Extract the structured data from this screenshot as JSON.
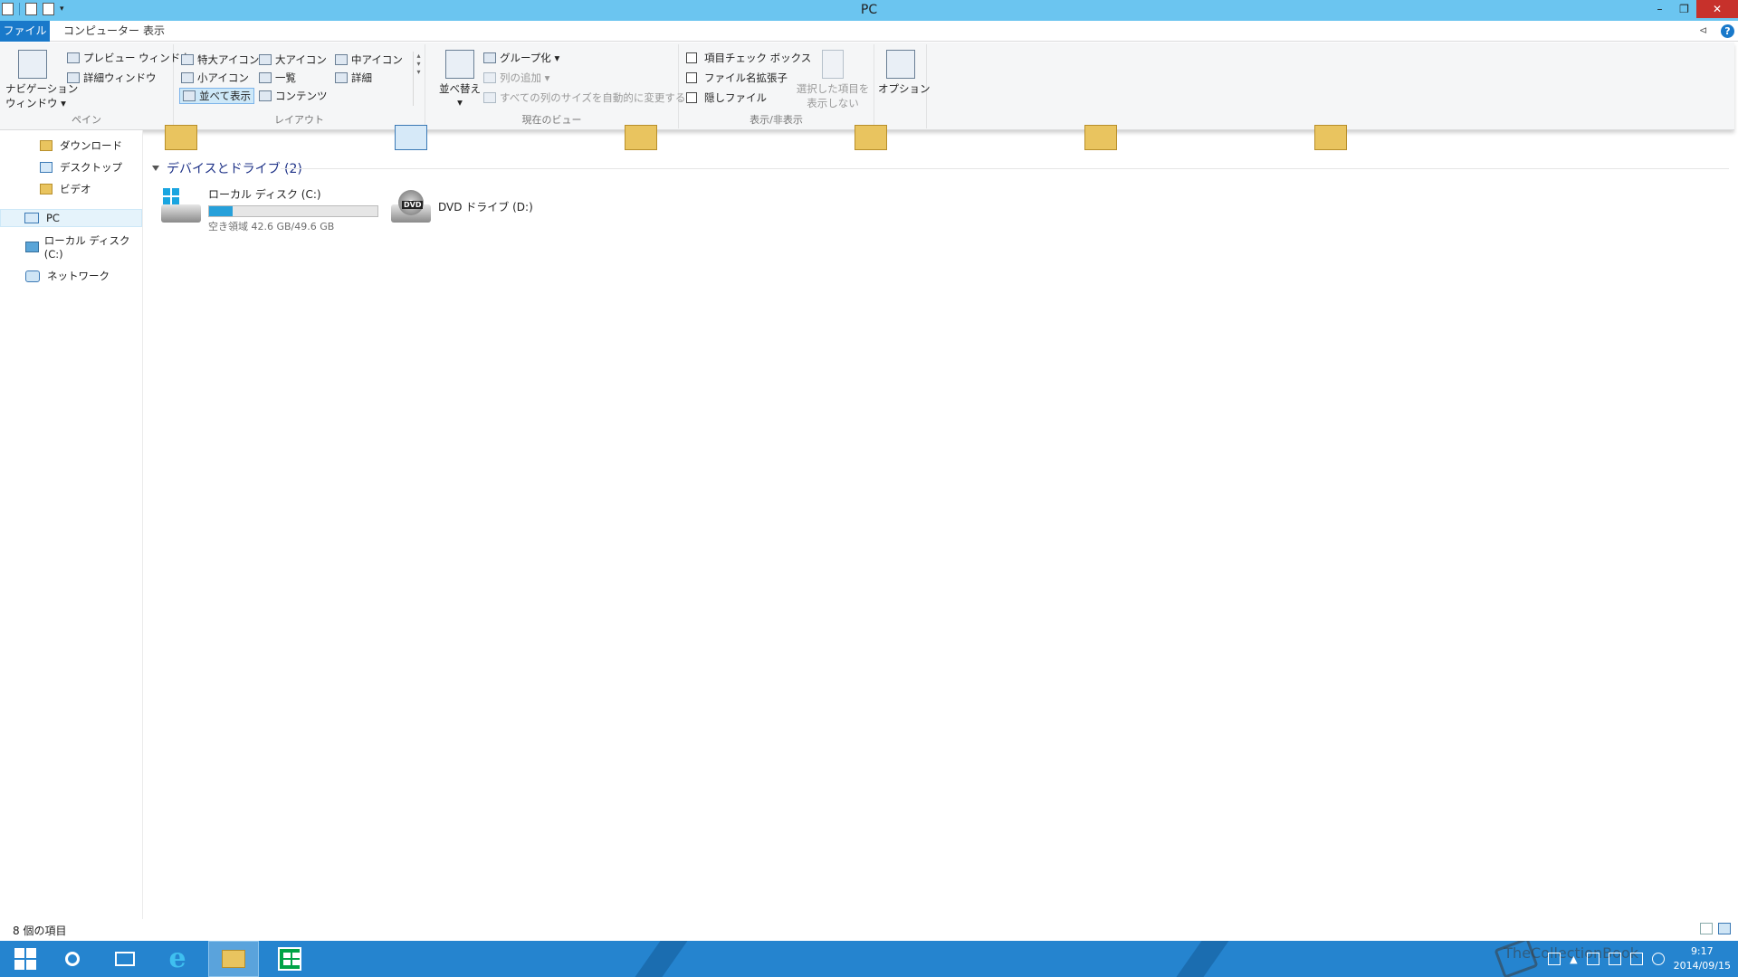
{
  "window": {
    "title": "PC"
  },
  "tabs": {
    "file": "ファイル",
    "computer": "コンピューター",
    "view": "表示"
  },
  "ribbon": {
    "pane": {
      "nav_window": "ナビゲーション",
      "nav_window_2": "ウィンドウ",
      "preview": "プレビュー ウィンドウ",
      "details": "詳細ウィンドウ",
      "label": "ペイン"
    },
    "layout": {
      "xl_icons": "特大アイコン",
      "l_icons": "大アイコン",
      "m_icons": "中アイコン",
      "s_icons": "小アイコン",
      "list": "一覧",
      "details": "詳細",
      "tiles": "並べて表示",
      "content": "コンテンツ",
      "label": "レイアウト"
    },
    "current_view": {
      "sort": "並べ替え",
      "group": "グループ化",
      "add_col": "列の追加",
      "fit_cols": "すべての列のサイズを自動的に変更する",
      "label": "現在のビュー"
    },
    "show_hide": {
      "item_checkbox": "項目チェック ボックス",
      "file_ext": "ファイル名拡張子",
      "hidden_files": "隠しファイル",
      "hide_selected": "選択した項目を",
      "hide_selected_2": "表示しない",
      "label": "表示/非表示"
    },
    "options": "オプション"
  },
  "nav": {
    "downloads": "ダウンロード",
    "desktop": "デスクトップ",
    "videos": "ビデオ",
    "pc": "PC",
    "local_disk": "ローカル ディスク (C:)",
    "network": "ネットワーク"
  },
  "content": {
    "section": "デバイスとドライブ (2)",
    "drive_c": {
      "name": "ローカル ディスク (C:)",
      "free": "空き領域 42.6 GB/49.6 GB",
      "used_fraction": 0.14
    },
    "drive_d": {
      "name": "DVD ドライブ (D:)",
      "badge": "DVD"
    }
  },
  "status": {
    "count": "8 個の項目"
  },
  "tray": {
    "time": "9:17",
    "date": "2014/09/15"
  },
  "watermark": "TheCollectionBook",
  "colors": {
    "titlebar": "#6bc5f0",
    "accent": "#1979ca",
    "taskbar": "#2584cf",
    "drive_fill": "#26a0da"
  }
}
